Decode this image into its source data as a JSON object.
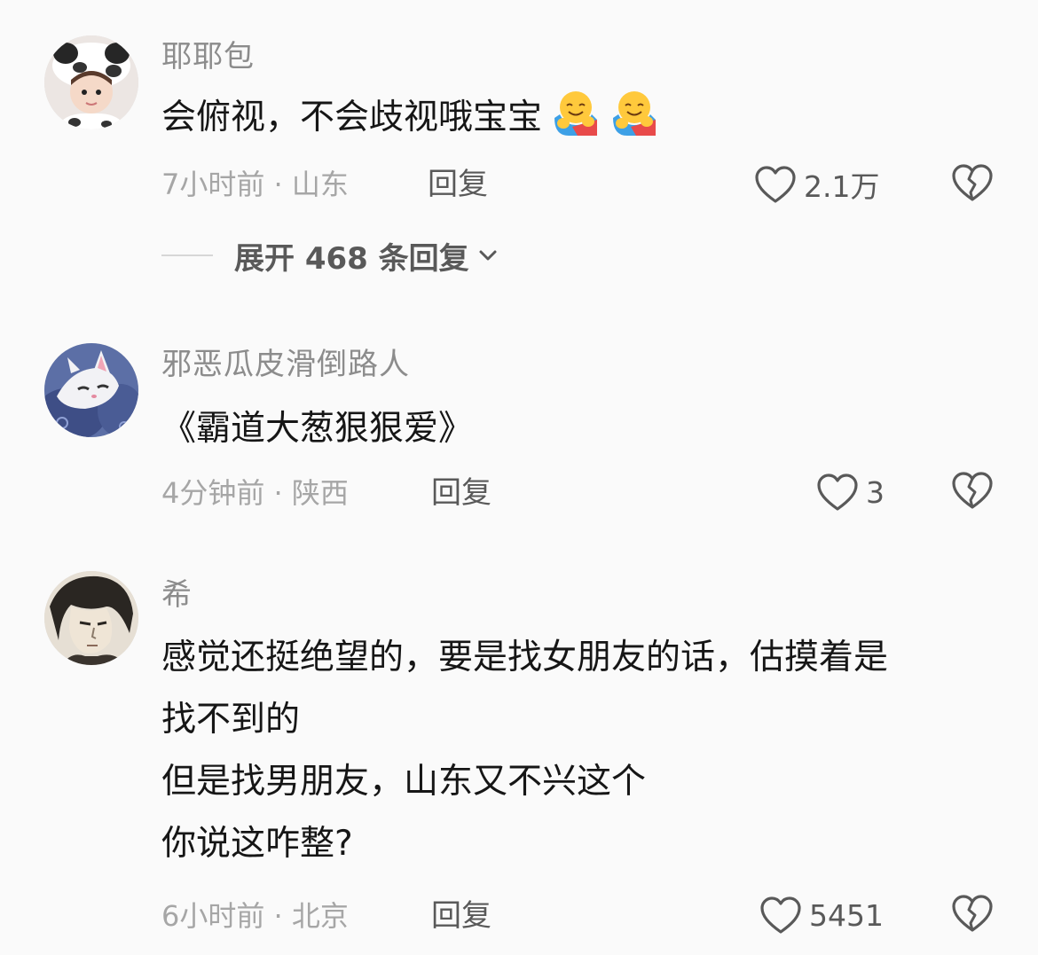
{
  "comments": [
    {
      "username": "耶耶包",
      "text": "会俯视，不会歧视哦宝宝",
      "emojis": [
        "hugging-face-emoji",
        "hugging-face-emoji"
      ],
      "time_location": "7小时前 · 山东",
      "reply_label": "回复",
      "likes": "2.1万",
      "avatar_icon": "baby-panda-hat-avatar",
      "expand_replies": "展开 468 条回复"
    },
    {
      "username": "邪恶瓜皮滑倒路人",
      "text": "《霸道大葱狠狠爱》",
      "time_location": "4分钟前 · 陕西",
      "reply_label": "回复",
      "likes": "3",
      "avatar_icon": "white-cat-avatar"
    },
    {
      "username": "希",
      "lines": [
        "感觉还挺绝望的，要是找女朋友的话，估摸着是",
        "找不到的",
        "但是找男朋友，山东又不兴这个",
        "你说这咋整?"
      ],
      "time_location": "6小时前 · 北京",
      "reply_label": "回复",
      "likes": "5451",
      "avatar_icon": "anime-man-avatar"
    }
  ],
  "icons": {
    "like": "heart-outline-icon",
    "dislike": "broken-heart-icon",
    "expand": "chevron-down-icon"
  },
  "colors": {
    "background": "#fafafa",
    "username": "#8c8c8c",
    "text": "#161616",
    "meta": "#a6a6a6",
    "action": "#595959"
  }
}
